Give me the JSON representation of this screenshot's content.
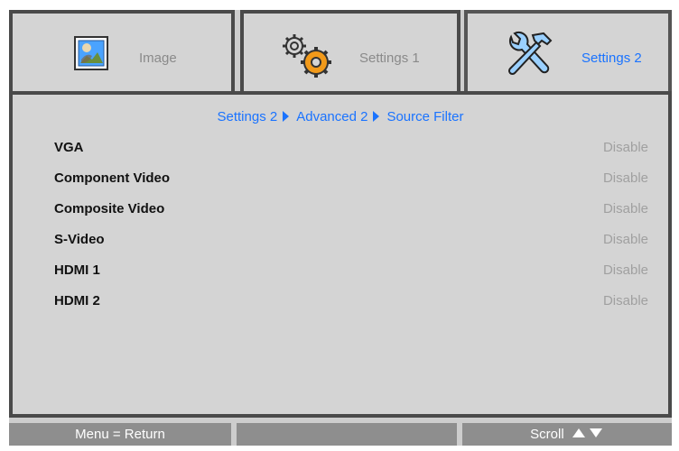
{
  "tabs": [
    {
      "label": "Image",
      "icon": "image-icon",
      "active": false
    },
    {
      "label": "Settings 1",
      "icon": "gears-icon",
      "active": false
    },
    {
      "label": "Settings 2",
      "icon": "tools-icon",
      "active": true
    }
  ],
  "breadcrumb": [
    "Settings 2",
    "Advanced 2",
    "Source Filter"
  ],
  "rows": [
    {
      "label": "VGA",
      "value": "Disable"
    },
    {
      "label": "Component Video",
      "value": "Disable"
    },
    {
      "label": "Composite Video",
      "value": "Disable"
    },
    {
      "label": "S-Video",
      "value": "Disable"
    },
    {
      "label": "HDMI 1",
      "value": "Disable"
    },
    {
      "label": "HDMI 2",
      "value": "Disable"
    }
  ],
  "bottom": {
    "left": "Menu = Return",
    "middle": "",
    "right": "Scroll"
  },
  "colors": {
    "accent": "#1a73ff",
    "panel": "#d4d4d4",
    "border": "#4a4a4a",
    "bottom_bar": "#8e8e8e",
    "disabled_value": "#a0a0a0"
  }
}
